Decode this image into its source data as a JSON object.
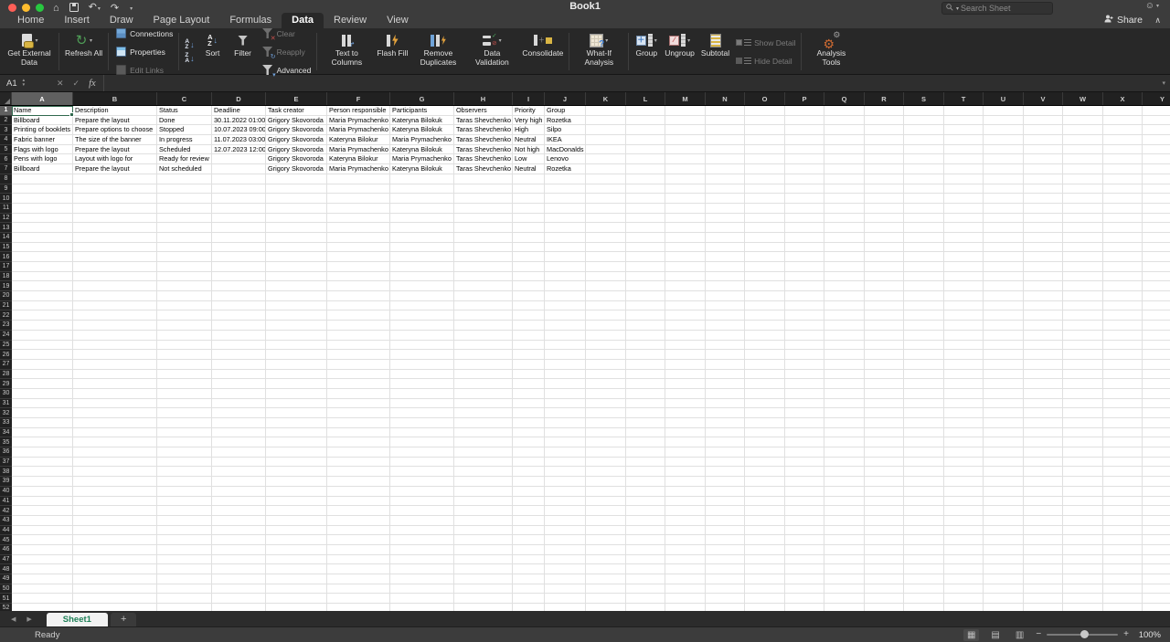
{
  "titlebar": {
    "title": "Book1",
    "search_placeholder": "Search Sheet",
    "share_label": "Share"
  },
  "tabs": {
    "items": [
      "Home",
      "Insert",
      "Draw",
      "Page Layout",
      "Formulas",
      "Data",
      "Review",
      "View"
    ],
    "active": "Data"
  },
  "ribbon": {
    "sections": [
      {
        "items": [
          {
            "type": "large",
            "label": "Get External Data",
            "icon": "get-external-data-icon",
            "dropdown": true
          }
        ]
      },
      {
        "items": [
          {
            "type": "large",
            "label": "Refresh All",
            "icon": "refresh-all-icon",
            "dropdown": true
          }
        ]
      },
      {
        "items": [
          {
            "type": "stack",
            "rows": [
              {
                "label": "Connections",
                "icon": "connections-icon"
              },
              {
                "label": "Properties",
                "icon": "properties-icon"
              },
              {
                "label": "Edit Links",
                "icon": "edit-links-icon",
                "disabled": true
              }
            ]
          }
        ]
      },
      {
        "items": [
          {
            "type": "sortmini"
          },
          {
            "type": "large",
            "label": "Sort",
            "icon": "sort-icon"
          },
          {
            "type": "large",
            "label": "Filter",
            "icon": "filter-icon"
          },
          {
            "type": "stack",
            "rows": [
              {
                "label": "Clear",
                "icon": "clear-filter-icon",
                "disabled": true
              },
              {
                "label": "Reapply",
                "icon": "reapply-filter-icon",
                "disabled": true
              },
              {
                "label": "Advanced",
                "icon": "advanced-filter-icon"
              }
            ]
          }
        ]
      },
      {
        "items": [
          {
            "type": "large",
            "label": "Text to Columns",
            "icon": "text-to-columns-icon"
          },
          {
            "type": "large",
            "label": "Flash Fill",
            "icon": "flash-fill-icon"
          },
          {
            "type": "large",
            "label": "Remove Duplicates",
            "icon": "remove-duplicates-icon"
          },
          {
            "type": "large",
            "label": "Data Validation",
            "icon": "data-validation-icon",
            "dropdown": true
          },
          {
            "type": "large",
            "label": "Consolidate",
            "icon": "consolidate-icon"
          }
        ]
      },
      {
        "items": [
          {
            "type": "large",
            "label": "What-If Analysis",
            "icon": "what-if-analysis-icon",
            "dropdown": true
          }
        ]
      },
      {
        "items": [
          {
            "type": "large",
            "label": "Group",
            "icon": "group-icon",
            "dropdown": true
          },
          {
            "type": "large",
            "label": "Ungroup",
            "icon": "ungroup-icon",
            "dropdown": true
          },
          {
            "type": "large",
            "label": "Subtotal",
            "icon": "subtotal-icon"
          },
          {
            "type": "stack",
            "rows": [
              {
                "label": "Show Detail",
                "icon": "show-detail-icon",
                "disabled": true
              },
              {
                "label": "Hide Detail",
                "icon": "hide-detail-icon",
                "disabled": true
              }
            ]
          }
        ]
      },
      {
        "items": [
          {
            "type": "large",
            "label": "Analysis Tools",
            "icon": "analysis-tools-icon"
          }
        ]
      }
    ]
  },
  "formula_bar": {
    "name_box": "A1",
    "fx_label": "fx",
    "input_value": ""
  },
  "sheet": {
    "visible_rows": 52,
    "selection": {
      "cell": "A1",
      "col": "A",
      "row": 1
    },
    "columns": [
      {
        "letter": "A",
        "width": 67
      },
      {
        "letter": "B",
        "width": 92
      },
      {
        "letter": "C",
        "width": 60
      },
      {
        "letter": "D",
        "width": 59
      },
      {
        "letter": "E",
        "width": 67
      },
      {
        "letter": "F",
        "width": 69
      },
      {
        "letter": "G",
        "width": 70
      },
      {
        "letter": "H",
        "width": 64
      },
      {
        "letter": "I",
        "width": 35
      },
      {
        "letter": "J",
        "width": 45
      },
      {
        "letter": "K",
        "width": 44
      },
      {
        "letter": "L",
        "width": 43
      },
      {
        "letter": "M",
        "width": 44
      },
      {
        "letter": "N",
        "width": 43
      },
      {
        "letter": "O",
        "width": 44
      },
      {
        "letter": "P",
        "width": 43
      },
      {
        "letter": "Q",
        "width": 44
      },
      {
        "letter": "R",
        "width": 43
      },
      {
        "letter": "S",
        "width": 44
      },
      {
        "letter": "T",
        "width": 43
      },
      {
        "letter": "U",
        "width": 44
      },
      {
        "letter": "V",
        "width": 43
      },
      {
        "letter": "W",
        "width": 44
      },
      {
        "letter": "X",
        "width": 43
      },
      {
        "letter": "Y",
        "width": 44
      }
    ],
    "table": {
      "headers": [
        "Name",
        "Description",
        "Status",
        "Deadline",
        "Task creator",
        "Person responsible",
        "Participants",
        "Observers",
        "Priority",
        "Group"
      ],
      "rows": [
        [
          "Billboard",
          "Prepare the layout",
          "Done",
          "30.11.2022 01:00",
          "Grigory Skovoroda",
          "Maria Prymachenko",
          "Kateryna Bilokuk",
          "Taras Shevchenko",
          "Very high",
          "Rozetka"
        ],
        [
          "Printing of booklets",
          "Prepare options to choose",
          "Stopped",
          "10.07.2023 09:00",
          "Grigory Skovoroda",
          "Maria Prymachenko",
          "Kateryna Bilokuk",
          "Taras Shevchenko",
          "High",
          "Silpo"
        ],
        [
          "Fabric banner",
          "The size of the banner",
          "In progress",
          "11.07.2023 03:00",
          "Grigory Skovoroda",
          "Kateryna Bilokur",
          "Maria Prymachenko",
          "Taras Shevchenko",
          "Neutral",
          "IKEA"
        ],
        [
          "Flags with logo",
          "Prepare the layout",
          "Scheduled",
          "12.07.2023 12:00",
          "Grigory Skovoroda",
          "Maria Prymachenko",
          "Kateryna Bilokuk",
          "Taras Shevchenko",
          "Not high",
          "MacDonalds"
        ],
        [
          "Pens with logo",
          "Layout with logo for",
          "Ready for review",
          "",
          "Grigory Skovoroda",
          "Kateryna Bilokur",
          "Maria Prymachenko",
          "Taras Shevchenko",
          "Low",
          "Lenovo"
        ],
        [
          "Billboard",
          "Prepare the layout",
          "Not scheduled",
          "",
          "Grigory Skovoroda",
          "Maria Prymachenko",
          "Kateryna Bilokuk",
          "Taras Shevchenko",
          "Neutral",
          "Rozetka"
        ]
      ]
    }
  },
  "sheet_tabs": {
    "active": "Sheet1",
    "add_label": "+"
  },
  "status_bar": {
    "status": "Ready",
    "zoom_level": "100%"
  },
  "colors": {
    "selection_border": "#31694e",
    "sheet_tab_text": "#1e8057",
    "traffic_red": "#ff5f57",
    "traffic_yellow": "#febc2e",
    "traffic_green": "#28c840"
  }
}
